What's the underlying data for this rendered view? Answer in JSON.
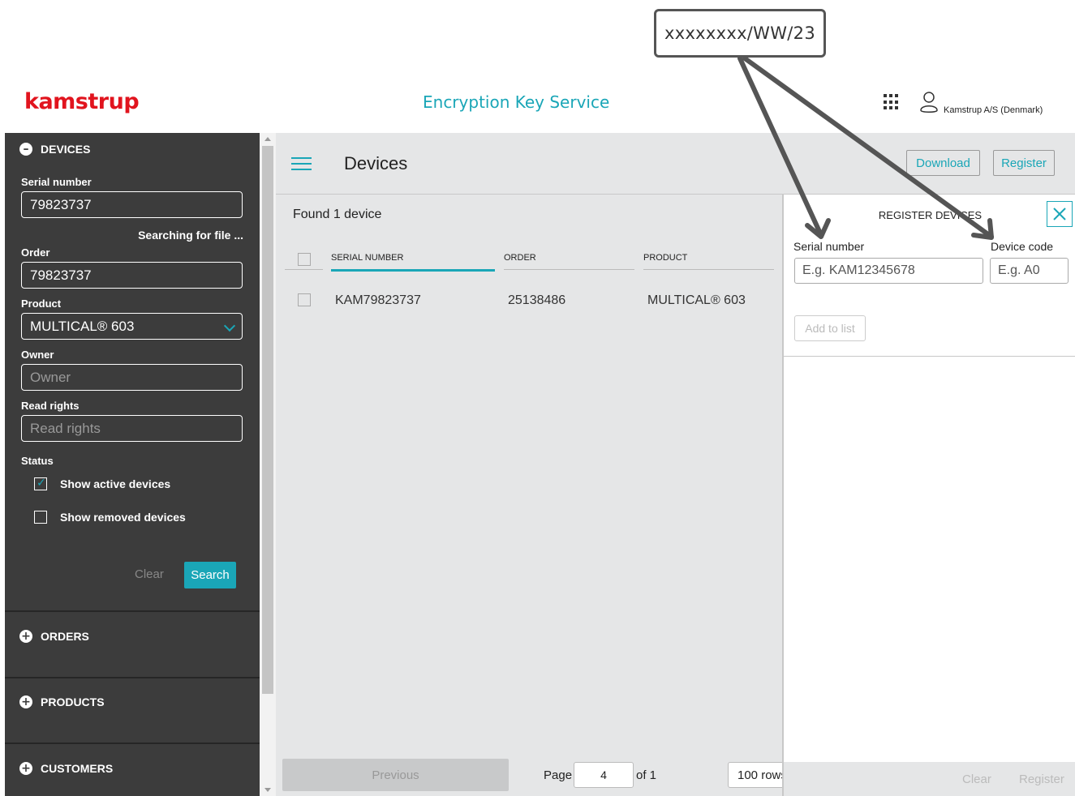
{
  "annotation": {
    "callout_text": "xxxxxxxx/WW/23"
  },
  "header": {
    "logo": "kamstrup",
    "app_title": "Encryption Key Service",
    "org_name": "Kamstrup A/S (Denmark)"
  },
  "sidebar": {
    "devices_section": "DEVICES",
    "serial_label": "Serial number",
    "serial_value": "79823737",
    "searching_text": "Searching for file ...",
    "order_label": "Order",
    "order_value": "79823737",
    "product_label": "Product",
    "product_value": "MULTICAL® 603",
    "owner_label": "Owner",
    "owner_placeholder": "Owner",
    "read_rights_label": "Read rights",
    "read_rights_placeholder": "Read rights",
    "status_label": "Status",
    "show_active": {
      "label": "Show active devices",
      "checked": true
    },
    "show_removed": {
      "label": "Show removed devices",
      "checked": false
    },
    "clear_label": "Clear",
    "search_label": "Search",
    "orders_section": "ORDERS",
    "products_section": "PRODUCTS",
    "customers_section": "CUSTOMERS"
  },
  "main": {
    "title": "Devices",
    "download_label": "Download",
    "register_label": "Register",
    "found_text": "Found 1 device",
    "columns": [
      "SERIAL NUMBER",
      "ORDER",
      "PRODUCT"
    ],
    "rows": [
      {
        "serial": "KAM79823737",
        "order": "25138486",
        "product": "MULTICAL® 603"
      }
    ],
    "pagination": {
      "previous_label": "Previous",
      "page_label": "Page",
      "page_value": "4",
      "of_label": "of 1",
      "rows_label": "100 rows"
    }
  },
  "register_panel": {
    "title": "REGISTER DEVICES",
    "serial_label": "Serial number",
    "serial_placeholder": "E.g. KAM12345678",
    "code_label": "Device code",
    "code_placeholder": "E.g. A0",
    "add_label": "Add to list",
    "clear_label": "Clear",
    "register_label": "Register"
  },
  "colors": {
    "accent": "#1aa6b7",
    "brand_red": "#e1141e",
    "sidebar_bg": "#3c3c3c",
    "main_bg": "#e5e6e7"
  }
}
